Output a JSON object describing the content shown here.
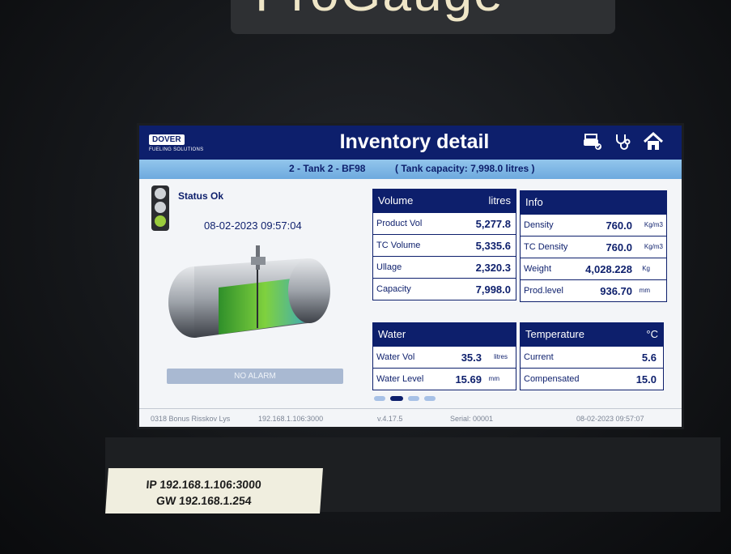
{
  "device": {
    "brand_text": "ProGauge"
  },
  "header": {
    "logo_text": "DOVER",
    "logo_subtext": "FUELING SOLUTIONS",
    "title": "Inventory detail",
    "icons": [
      "printer-check-icon",
      "stethoscope-icon",
      "home-icon"
    ]
  },
  "subheader": {
    "tank_name": "2 - Tank 2 - BF98",
    "tank_capacity": "( Tank capacity: 7,998.0 litres )"
  },
  "status": {
    "text": "Status Ok",
    "timestamp": "08-02-2023 09:57:04",
    "alarm_label": "NO ALARM"
  },
  "volume": {
    "title": "Volume",
    "unit": "litres",
    "rows": [
      {
        "label": "Product Vol",
        "value": "5,277.8"
      },
      {
        "label": "TC Volume",
        "value": "5,335.6"
      },
      {
        "label": "Ullage",
        "value": "2,320.3"
      },
      {
        "label": "Capacity",
        "value": "7,998.0"
      }
    ]
  },
  "info": {
    "title": "Info",
    "rows": [
      {
        "label": "Density",
        "value": "760.0",
        "unit": "Kg/m3"
      },
      {
        "label": "TC Density",
        "value": "760.0",
        "unit": "Kg/m3"
      },
      {
        "label": "Weight",
        "value": "4,028.228",
        "unit": "Kg"
      },
      {
        "label": "Prod.level",
        "value": "936.70",
        "unit": "mm"
      }
    ]
  },
  "water": {
    "title": "Water",
    "rows": [
      {
        "label": "Water Vol",
        "value": "35.3",
        "unit": "litres"
      },
      {
        "label": "Water Level",
        "value": "15.69",
        "unit": "mm"
      }
    ]
  },
  "temperature": {
    "title": "Temperature",
    "unit": "°C",
    "rows": [
      {
        "label": "Current",
        "value": "5.6"
      },
      {
        "label": "Compensated",
        "value": "15.0"
      }
    ]
  },
  "pager": {
    "count": 4,
    "active": 2
  },
  "footer": {
    "site": "0318 Bonus Risskov Lys",
    "ip": "192.168.1.106:3000",
    "version": "v.4.17.5",
    "serial": "Serial: 00001",
    "datetime": "08-02-2023  09:57:07"
  },
  "sticker": {
    "ip_line": "IP 192.168.1.106:3000",
    "gw_line": "GW 192.168.1.254"
  },
  "colors": {
    "navy": "#0d1f6c",
    "sky": "#7eb7e6",
    "fuel": "#6fcf3b"
  }
}
